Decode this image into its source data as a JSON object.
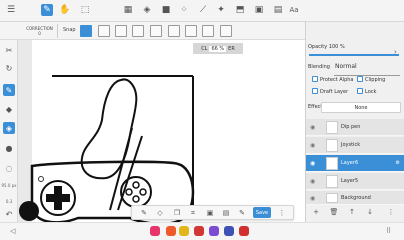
{
  "toolbar": {
    "icons": [
      "menu-icon",
      "pen-icon",
      "hand-icon",
      "lasso-icon",
      "layers-grid-icon",
      "bucket-icon",
      "fill-icon",
      "eyedropper-icon",
      "magic-wand-icon",
      "select-icon",
      "transform-icon",
      "text-icon"
    ],
    "text_tool_label": "Aa"
  },
  "subbar": {
    "correction_label": "CORRECTION",
    "correction_value": "0",
    "snap_label": "Snap"
  },
  "canvas": {
    "zoom_left": "CL",
    "zoom_percent": "66 %",
    "zoom_right": "ER"
  },
  "leftbar": {
    "brush_size_value": "95.0 px",
    "brush_size_value_2": "0.3"
  },
  "panel": {
    "opacity_label": "Opacity 100 %",
    "opacity_value": 100,
    "blending_label": "Blending",
    "blending_value": "Normal",
    "protect_alpha": "Protect Alpha",
    "clipping": "Clipping",
    "draft_layer": "Draft Layer",
    "lock": "Lock",
    "effect_label": "Effect",
    "effect_value": "None",
    "layers": [
      {
        "name": "Dip pen",
        "selected": false
      },
      {
        "name": "Joystick",
        "selected": false
      },
      {
        "name": "Layer6",
        "selected": true
      },
      {
        "name": "Layer5",
        "selected": false
      },
      {
        "name": "Background",
        "selected": false
      }
    ]
  },
  "floatbar": {
    "save_label": "Save"
  },
  "colors": {
    "accent": "#3a8fd6",
    "toolbar_bg": "#f4f4f4",
    "canvas_bg": "#ffffff"
  }
}
